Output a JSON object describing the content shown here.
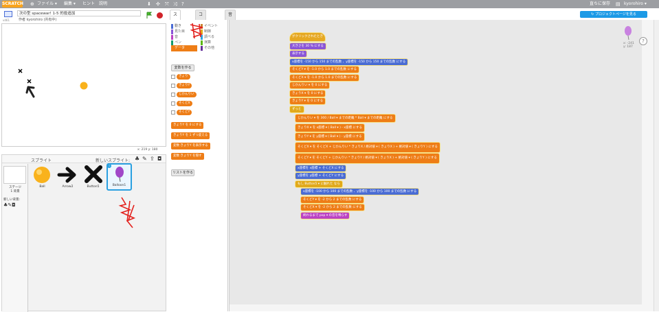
{
  "topbar": {
    "logo": "SCRATCH",
    "menus": [
      "ファイル ▾",
      "編集 ▾",
      "ヒント",
      "説明"
    ],
    "save_now": "直ちに保存",
    "user": "kyorohiro ▾"
  },
  "project": {
    "title": "次の型 spacewar! 1-5 的投追加",
    "author": "作者 kyorohiro (共有中)",
    "version": "v461"
  },
  "coords": {
    "label": "x: 219  y: 180"
  },
  "sprite_preview": {
    "label": "x: -241\ny: 187"
  },
  "tabs": [
    "スクリプト",
    "コスチューム",
    "音"
  ],
  "share_button": "プロジェクトページを見る",
  "categories": [
    {
      "label": "動き",
      "color": "#4a6cd4"
    },
    {
      "label": "イベント",
      "color": "#c88330"
    },
    {
      "label": "見た目",
      "color": "#8a55d7"
    },
    {
      "label": "制御",
      "color": "#e1a91a"
    },
    {
      "label": "音",
      "color": "#bb42c3"
    },
    {
      "label": "調べる",
      "color": "#2ca5e2"
    },
    {
      "label": "ペン",
      "color": "#0e9a6c"
    },
    {
      "label": "演算",
      "color": "#5cb712"
    },
    {
      "label": "データ",
      "color": "#ee7d16"
    },
    {
      "label": "その他",
      "color": "#632d99"
    }
  ],
  "palette": {
    "make_var": "変数を作る",
    "vars": [
      "きょり",
      "きょりY",
      "じかんりい",
      "そくどX",
      "そくどY"
    ],
    "blocks": [
      "きょりY を 0 にする",
      "きょりY を 1 ずつ変える",
      "変数 きょりY を表示する",
      "変数 きょりY を隠す"
    ],
    "make_list": "リストを作る"
  },
  "sprites": {
    "header": "スプライト",
    "new_sprite": "新しいスプライト:",
    "stage_label": "ステージ\n1 背景",
    "new_backdrop": "新しい背景:",
    "items": [
      "Ball",
      "Arrow2",
      "Button5",
      "Balloon1"
    ]
  },
  "script": [
    {
      "t": "hat",
      "text": "がクリックされたとき"
    },
    {
      "t": "looks",
      "text": "大きさを 30 % にする"
    },
    {
      "t": "looks",
      "text": "表示する"
    },
    {
      "t": "motion",
      "text": "x座標を -150 から 150 までの乱数 、y座標を -150 から 150 までの乱数 にする"
    },
    {
      "t": "data",
      "text": "そくどY ▾ を -1.0 から 1.0 までの乱数 にする"
    },
    {
      "t": "data",
      "text": "そくどX ▾ を -1.0 から 1.0 までの乱数 にする"
    },
    {
      "t": "data",
      "text": "じかんりい ▾ を 0 にする"
    },
    {
      "t": "data",
      "text": "きょりX ▾ を 0 にする"
    },
    {
      "t": "data",
      "text": "きょりY ▾ を 0 にする"
    },
    {
      "t": "ctrl",
      "text": "ずっと"
    },
    {
      "t": "data",
      "text": "じかんりい ▾ を 300 / Ball ▾ までの距離 * Ball ▾ までの距離 にする"
    },
    {
      "t": "data",
      "text": "きょりX ▾ を x座標 ▾ ( Ball ▾ ) - x座標 にする"
    },
    {
      "t": "data",
      "text": "きょりY ▾ を y座標 ▾ ( Ball ▾ ) - y座標 にする"
    },
    {
      "t": "data",
      "text": "そくどX ▾ を そくどX + じかんりい * きょりX / 絶対値 ▾ ( きょりX ) + 絶対値 ▾ ( きょりY ) にする"
    },
    {
      "t": "data",
      "text": "そくどY ▾ を そくどY + じかんりい * きょりY / 絶対値 ▾ ( きょりX ) + 絶対値 ▾ ( きょりY ) にする"
    },
    {
      "t": "motion",
      "text": "x座標を x座標 + そくどX にする"
    },
    {
      "t": "motion",
      "text": "y座標を y座標 + そくどY にする"
    },
    {
      "t": "ctrl",
      "text": "もし Button5 ▾ に触れた なら"
    },
    {
      "t": "motion",
      "text": "x座標を -100 から 100 までの乱数 、y座標を -100 から 100 までの乱数 にする"
    },
    {
      "t": "data",
      "text": "そくどY ▾ を -2 から 2 までの乱数 にする"
    },
    {
      "t": "data",
      "text": "そくどX ▾ を -2 から 2 までの乱数 にする"
    },
    {
      "t": "sound",
      "text": "終わるまで pop ▾ の音を鳴らす"
    }
  ]
}
